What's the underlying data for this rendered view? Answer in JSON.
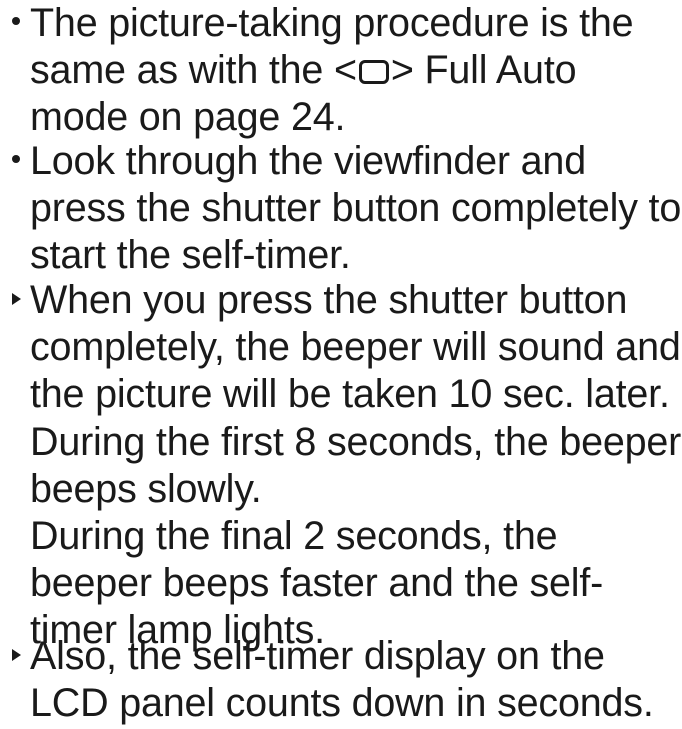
{
  "items": [
    {
      "marker": "dot",
      "line1": "The picture-taking procedure is the",
      "line2_before": "same as with the <",
      "line2_icon": "full-auto-mode-icon",
      "line2_after": "> Full Auto",
      "line3": "mode on page 24."
    },
    {
      "marker": "dot",
      "lines": [
        "Look through the viewfinder and",
        "press the shutter button completely to",
        "start the self-timer."
      ]
    },
    {
      "marker": "arrow",
      "lines": [
        "When you press the shutter button",
        "completely, the beeper will sound and",
        "the picture will be taken 10 sec. later.",
        "During the first 8 seconds, the beeper",
        "beeps slowly.",
        "During the final 2 seconds, the",
        "beeper beeps faster and the self-",
        "timer lamp lights."
      ]
    },
    {
      "marker": "arrow",
      "lines": [
        "Also, the self-timer display on the",
        "LCD panel counts down in seconds."
      ]
    }
  ]
}
